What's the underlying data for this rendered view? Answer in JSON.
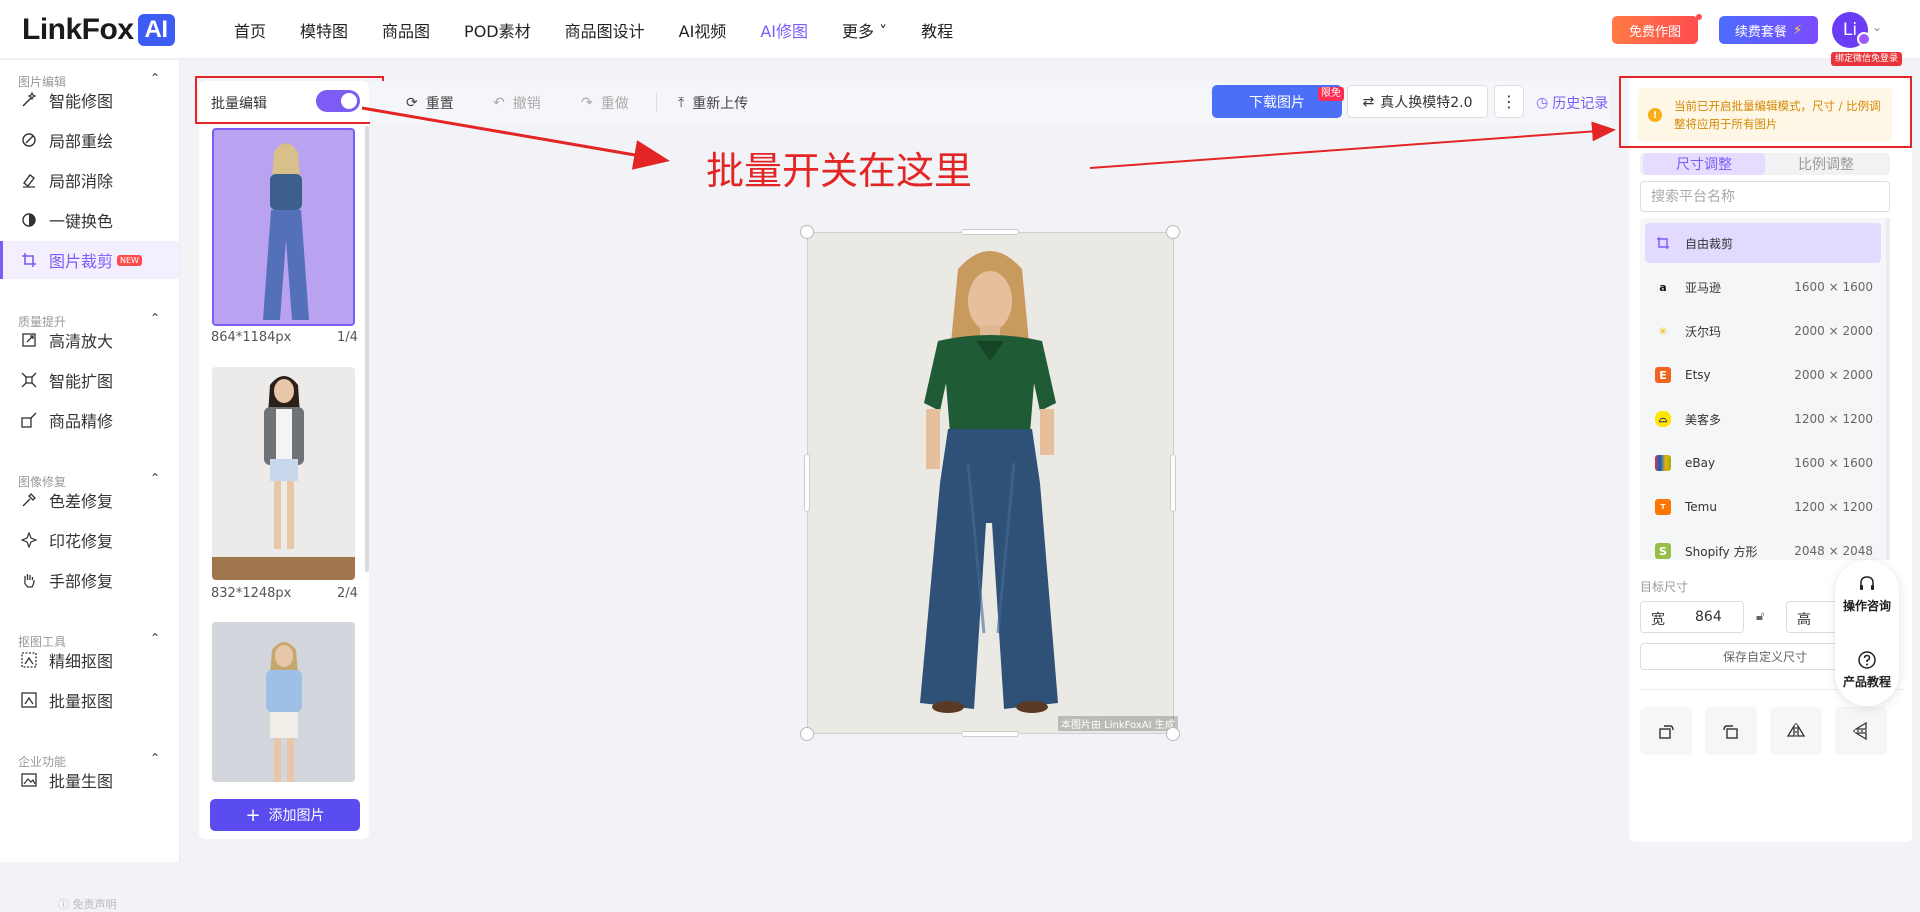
{
  "header": {
    "logo_text": "LinkFox",
    "logo_badge": "AI",
    "nav": [
      {
        "label": "首页"
      },
      {
        "label": "模特图"
      },
      {
        "label": "商品图"
      },
      {
        "label": "POD素材"
      },
      {
        "label": "商品图设计"
      },
      {
        "label": "AI视频"
      },
      {
        "label": "AI修图"
      },
      {
        "label": "更多 ˅"
      },
      {
        "label": "教程"
      }
    ],
    "active_nav": "AI修图",
    "free_btn": "免费作图",
    "renew_btn": "续费套餐",
    "avatar_text": "Li",
    "wechat_tag": "绑定微信免登录"
  },
  "sidebar": {
    "sections": [
      {
        "title": "图片编辑",
        "items": [
          {
            "label": "智能修图",
            "icon": "magic-wand-icon"
          },
          {
            "label": "局部重绘",
            "icon": "paint-brush-icon"
          },
          {
            "label": "局部消除",
            "icon": "eraser-icon"
          },
          {
            "label": "一键换色",
            "icon": "color-swap-icon"
          },
          {
            "label": "图片裁剪",
            "icon": "crop-icon"
          }
        ]
      },
      {
        "title": "质量提升",
        "items": [
          {
            "label": "高清放大",
            "icon": "upscale-icon"
          },
          {
            "label": "智能扩图",
            "icon": "expand-icon"
          },
          {
            "label": "商品精修",
            "icon": "retouch-icon"
          }
        ]
      },
      {
        "title": "图像修复",
        "items": [
          {
            "label": "色差修复",
            "icon": "color-fix-icon"
          },
          {
            "label": "印花修复",
            "icon": "print-fix-icon"
          },
          {
            "label": "手部修复",
            "icon": "hand-icon"
          }
        ]
      },
      {
        "title": "抠图工具",
        "items": [
          {
            "label": "精细抠图",
            "icon": "cutout-icon"
          },
          {
            "label": "批量抠图",
            "icon": "batch-cutout-icon"
          }
        ]
      },
      {
        "title": "企业功能",
        "items": [
          {
            "label": "批量生图",
            "icon": "image-icon"
          }
        ]
      }
    ],
    "new_badge": "NEW",
    "disclaimer": "免责声明"
  },
  "thumbnails": {
    "batch_label": "批量编辑",
    "batch_on": true,
    "items": [
      {
        "size": "864*1184px",
        "index": "1/4"
      },
      {
        "size": "832*1248px",
        "index": "2/4"
      }
    ],
    "add_button": "添加图片"
  },
  "toolbar": {
    "reset": "重置",
    "undo": "撤销",
    "redo": "重做",
    "reupload": "重新上传",
    "download": "下载图片",
    "limit_badge": "限免",
    "swap_model": "真人换模特2.0",
    "history": "历史记录"
  },
  "annotation_text": "批量开关在这里",
  "canvas": {
    "watermark": "本图片由 LinkFoxAI 生成"
  },
  "right_panel": {
    "warning": "当前已开启批量编辑模式，尺寸 / 比例调整将应用于所有图片",
    "tabs": [
      {
        "label": "尺寸调整"
      },
      {
        "label": "比例调整"
      }
    ],
    "search_placeholder": "搜索平台名称",
    "platforms": [
      {
        "name": "自由裁剪",
        "size": ""
      },
      {
        "name": "亚马逊",
        "size": "1600 × 1600"
      },
      {
        "name": "沃尔玛",
        "size": "2000 × 2000"
      },
      {
        "name": "Etsy",
        "size": "2000 × 2000"
      },
      {
        "name": "美客多",
        "size": "1200 × 1200"
      },
      {
        "name": "eBay",
        "size": "1600 × 1600"
      },
      {
        "name": "Temu",
        "size": "1200 × 1200"
      },
      {
        "name": "Shopify 方形",
        "size": "2048 × 2048"
      }
    ],
    "target_size_label": "目标尺寸",
    "width_label": "宽",
    "width_value": "864",
    "height_label": "高",
    "save_custom": "保存自定义尺寸"
  },
  "float_help": {
    "consult": "操作咨询",
    "tutorial": "产品教程"
  },
  "colors": {
    "accent": "#7c5cf5",
    "download": "#4b6ff7",
    "annotation": "#e32525"
  }
}
